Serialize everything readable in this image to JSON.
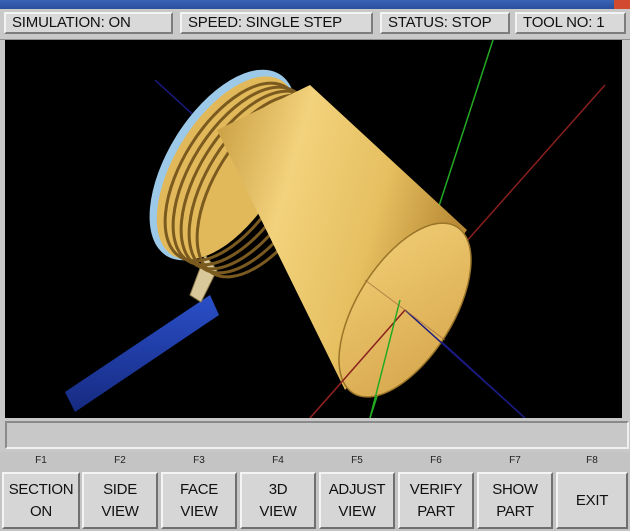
{
  "status_bar": {
    "simulation": "SIMULATION: ON",
    "speed": "SPEED: SINGLE STEP",
    "status": "STATUS: STOP",
    "tool": "TOOL NO:  1"
  },
  "function_keys": [
    {
      "key": "F1",
      "line1": "SECTION",
      "line2": "ON"
    },
    {
      "key": "F2",
      "line1": "SIDE",
      "line2": "VIEW"
    },
    {
      "key": "F3",
      "line1": "FACE",
      "line2": "VIEW"
    },
    {
      "key": "F4",
      "line1": "3D",
      "line2": "VIEW"
    },
    {
      "key": "F5",
      "line1": "ADJUST",
      "line2": "VIEW"
    },
    {
      "key": "F6",
      "line1": "VERIFY",
      "line2": "PART"
    },
    {
      "key": "F7",
      "line1": "SHOW",
      "line2": "PART"
    },
    {
      "key": "F8",
      "line1": "EXIT",
      "line2": ""
    }
  ],
  "colors": {
    "viewport_background": "#000000",
    "workpiece": "#e9c466",
    "tool_holder": "#1f3aa8",
    "axis_x": "#8a1f1f",
    "axis_y": "#22aa22",
    "axis_z": "#1a1a8a"
  }
}
